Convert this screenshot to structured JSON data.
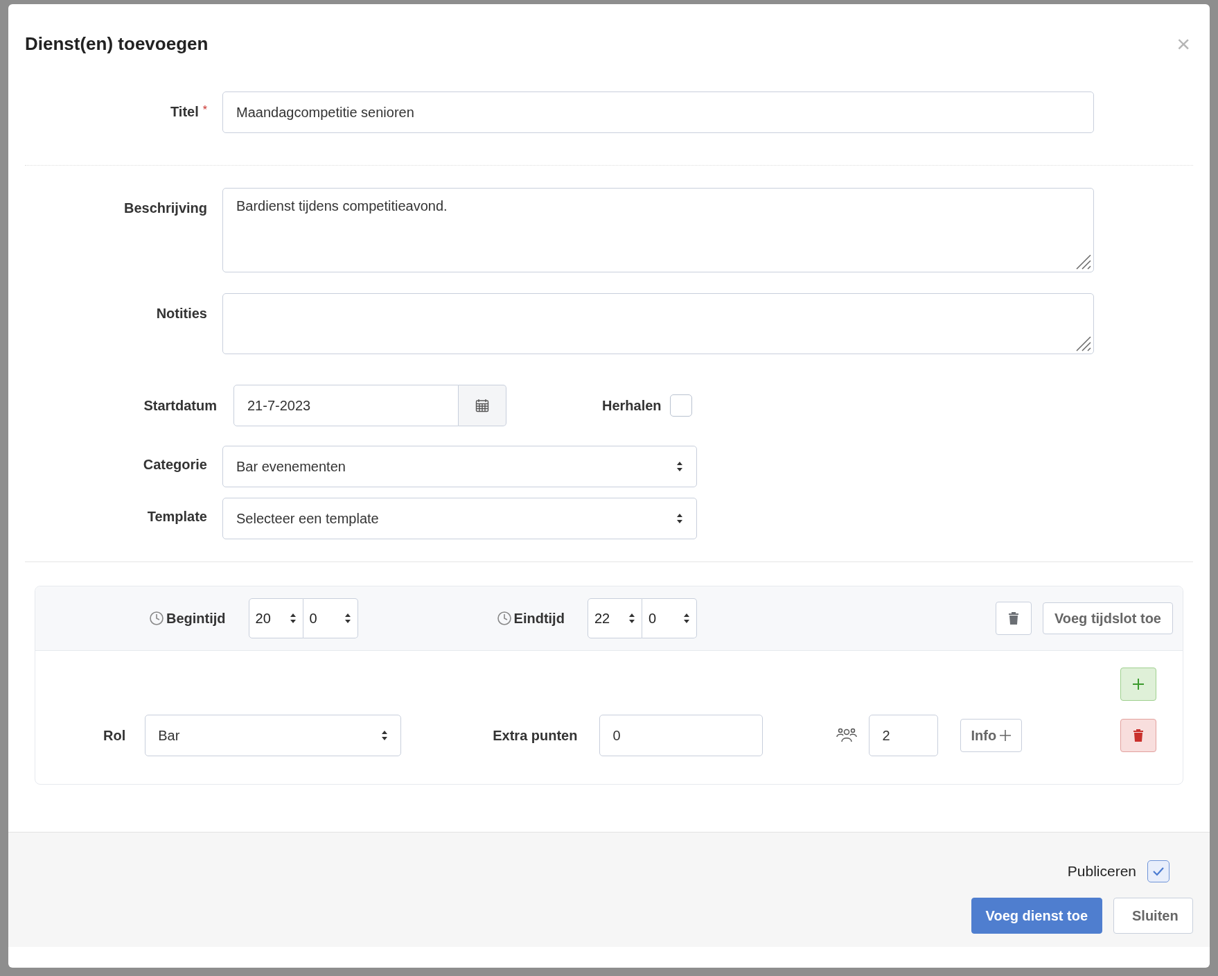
{
  "dialog": {
    "title": "Dienst(en) toevoegen",
    "close_icon": "×"
  },
  "fields": [
    {
      "kind": "text",
      "label": "Titel",
      "required_mark": "*",
      "value": "Maandagcompetitie senioren"
    },
    {
      "kind": "textarea",
      "label": "Beschrijving",
      "value": "Bardienst tijdens competitieavond."
    },
    {
      "kind": "textarea_small",
      "label": "Notities"
    }
  ],
  "start_date": {
    "label": "Startdatum",
    "value": "21-7-2023"
  },
  "repeat": {
    "label": "Herhalen",
    "checked": false
  },
  "selects": [
    {
      "label": "Categorie",
      "value": "Bar evenementen"
    },
    {
      "label": "Template",
      "value": "Selecteer een template"
    }
  ],
  "timeslot": {
    "start": {
      "label": "Begintijd",
      "hour": "20",
      "minute": "0"
    },
    "end": {
      "label": "Eindtijd",
      "hour": "22",
      "minute": "0"
    },
    "add_button": "Voeg tijdslot toe",
    "roles": [
      {
        "label": "Rol",
        "role": "Bar",
        "points_label": "Extra punten",
        "points": "0",
        "people": "2",
        "info_button": "Info"
      }
    ]
  },
  "footer": {
    "publish": {
      "label": "Publiceren",
      "checked": true
    },
    "buttons": [
      {
        "kind": "primary",
        "label": "Voeg dienst toe"
      },
      {
        "kind": "secondary",
        "label": "Sluiten"
      }
    ]
  }
}
